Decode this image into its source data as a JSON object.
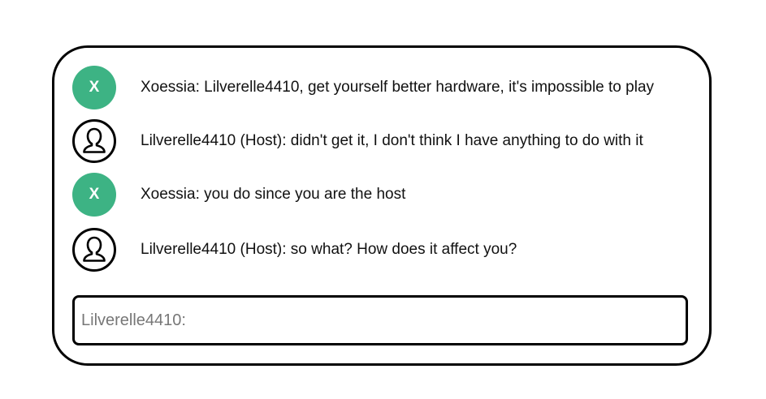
{
  "colors": {
    "avatar_letter_bg": "#3db384",
    "border": "#000000",
    "prompt_text": "#777777"
  },
  "messages": [
    {
      "avatar": {
        "type": "letter",
        "letter": "X"
      },
      "text": "Xoessia: Lilverelle4410, get yourself better hardware, it's impossible to play"
    },
    {
      "avatar": {
        "type": "icon",
        "icon": "user-icon"
      },
      "text": "Lilverelle4410 (Host): didn't get it, I don't think I have anything to do with it"
    },
    {
      "avatar": {
        "type": "letter",
        "letter": "X"
      },
      "text": "Xoessia: you do since you are the host"
    },
    {
      "avatar": {
        "type": "icon",
        "icon": "user-icon"
      },
      "text": "Lilverelle4410 (Host): so what? How does it affect you?"
    }
  ],
  "input": {
    "prompt": "Lilverelle4410:"
  }
}
